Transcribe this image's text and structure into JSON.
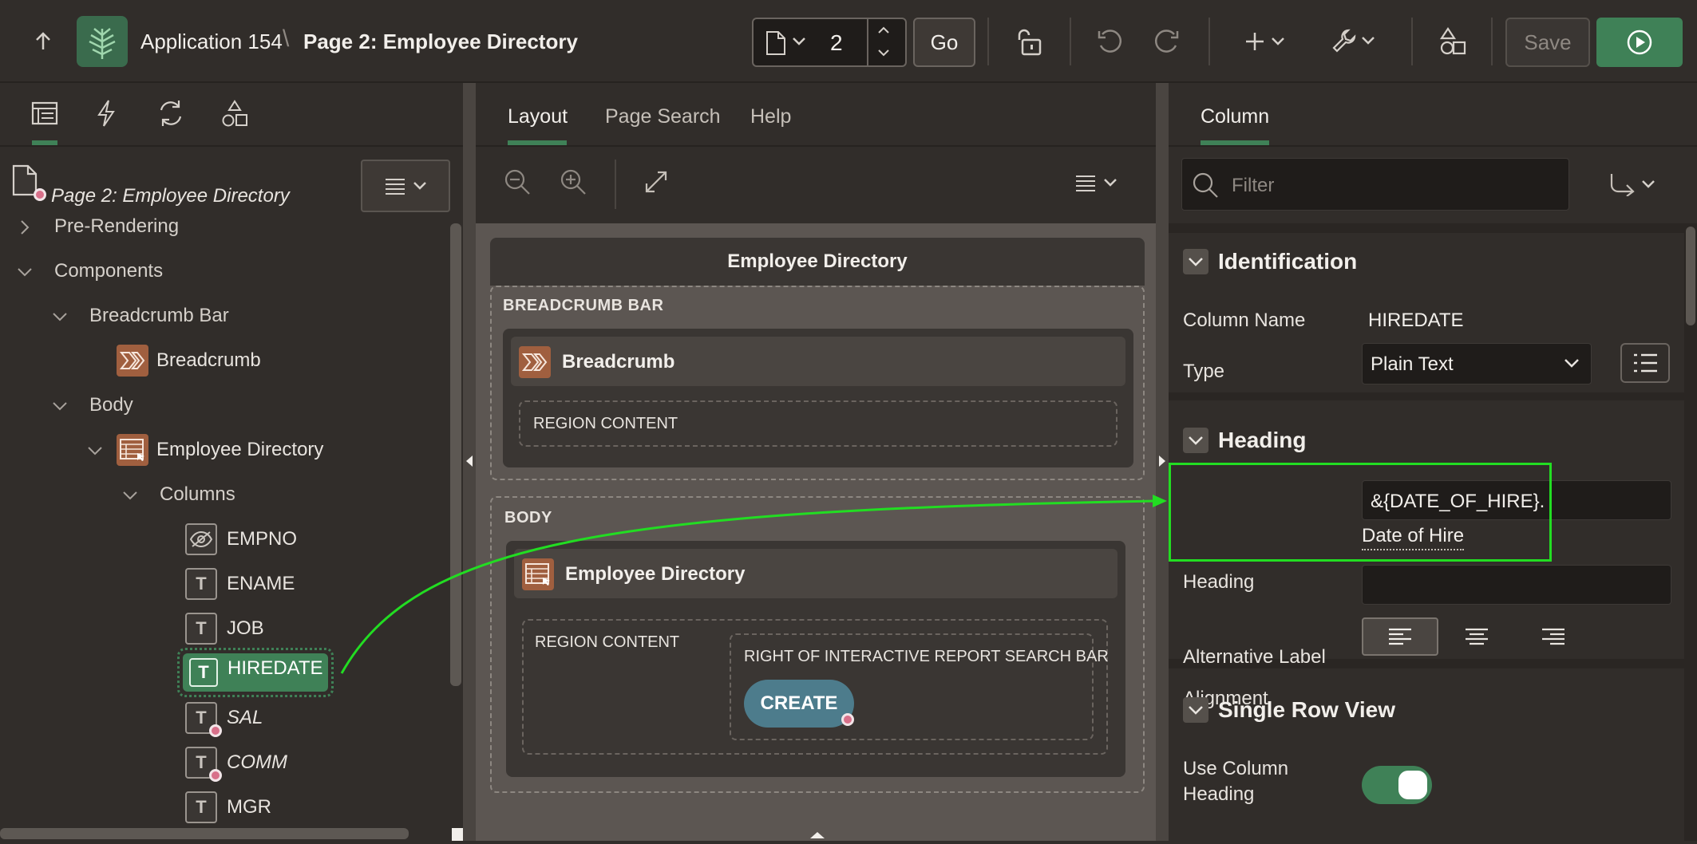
{
  "toolbar": {
    "app_name": "Application 154",
    "separator": "\\",
    "page_title": "Page 2: Employee Directory",
    "page_number": "2",
    "go_label": "Go",
    "save_label": "Save"
  },
  "left": {
    "page_node": "Page 2: Employee Directory",
    "tree": {
      "pre_rendering": "Pre-Rendering",
      "components": "Components",
      "breadcrumb_bar": "Breadcrumb Bar",
      "breadcrumb": "Breadcrumb",
      "body": "Body",
      "employee_directory": "Employee Directory",
      "columns": "Columns",
      "cols": [
        "EMPNO",
        "ENAME",
        "JOB",
        "HIREDATE",
        "SAL",
        "COMM",
        "MGR"
      ]
    }
  },
  "center": {
    "tabs": [
      "Layout",
      "Page Search",
      "Help"
    ],
    "page_header": "Employee Directory",
    "breadcrumb_bar_label": "BREADCRUMB BAR",
    "breadcrumb_region": "Breadcrumb",
    "region_content_1": "REGION CONTENT",
    "body_label": "BODY",
    "employee_region": "Employee Directory",
    "region_content_2": "REGION CONTENT",
    "right_of_search": "RIGHT OF INTERACTIVE REPORT SEARCH BAR",
    "create_button": "CREATE"
  },
  "right": {
    "tab": "Column",
    "filter_placeholder": "Filter",
    "identification": "Identification",
    "column_name_label": "Column Name",
    "column_name_value": "HIREDATE",
    "type_label": "Type",
    "type_value": "Plain Text",
    "heading_section": "Heading",
    "heading_label": "Heading",
    "heading_value": "&{DATE_OF_HIRE}.",
    "heading_resolved": "Date of Hire",
    "alt_label": "Alternative Label",
    "alignment_label": "Alignment",
    "single_row_view": "Single Row View",
    "use_col_heading_1": "Use Column",
    "use_col_heading_2": "Heading"
  },
  "colors": {
    "accent_green": "#3f8157",
    "highlight_green": "#22dd22",
    "brown_icon": "#a05f3f",
    "create_teal": "#4d7c8c"
  }
}
